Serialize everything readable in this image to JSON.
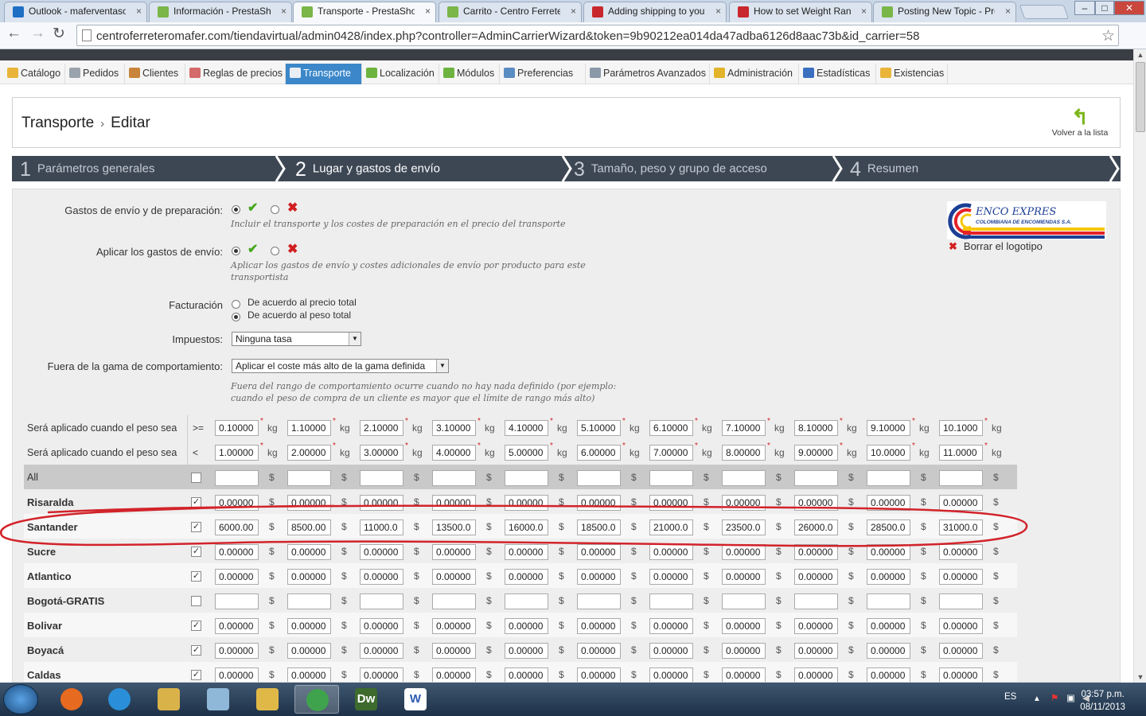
{
  "browser": {
    "tabs": [
      {
        "title": "Outlook - maferventaso",
        "color": "#1f6fc5"
      },
      {
        "title": "Información - PrestaSho",
        "color": "#7ab648"
      },
      {
        "title": "Transporte - PrestaShop",
        "color": "#7ab648",
        "active": true
      },
      {
        "title": "Carrito - Centro Ferreter",
        "color": "#7ab648"
      },
      {
        "title": "Adding shipping to you",
        "color": "#c8282d"
      },
      {
        "title": "How to set Weight Rang",
        "color": "#c8282d"
      },
      {
        "title": "Posting New Topic - Pre",
        "color": "#7ab648"
      }
    ],
    "url": "centroferreteromafer.com/tiendavirtual/admin0428/index.php?controller=AdminCarrierWizard&token=9b90212ea014da47adba6126d8aac73b&id_carrier=58"
  },
  "menu": [
    {
      "label": "Catálogo",
      "icon": "folder-icon",
      "color": "#e8b53a"
    },
    {
      "label": "Pedidos",
      "icon": "cart-icon",
      "color": "#9aa3ad"
    },
    {
      "label": "Clientes",
      "icon": "user-icon",
      "color": "#c9843b"
    },
    {
      "label": "Reglas de precios",
      "icon": "price-rules-icon",
      "color": "#d46a6a"
    },
    {
      "label": "Transporte",
      "icon": "truck-icon",
      "color": "#e9eef4",
      "active": true
    },
    {
      "label": "Localización",
      "icon": "globe-icon",
      "color": "#6db33f"
    },
    {
      "label": "Módulos",
      "icon": "puzzle-icon",
      "color": "#6db33f"
    },
    {
      "label": "Preferencias",
      "icon": "preferences-icon",
      "color": "#5a8bc2"
    },
    {
      "label": "Parámetros Avanzados",
      "icon": "wrench-icon",
      "color": "#8a98a8"
    },
    {
      "label": "Administración",
      "icon": "key-icon",
      "color": "#e1b42a"
    },
    {
      "label": "Estadísticas",
      "icon": "chart-icon",
      "color": "#3b6fc0"
    },
    {
      "label": "Existencias",
      "icon": "stock-icon",
      "color": "#e8b53a"
    }
  ],
  "header": {
    "breadcrumb_1": "Transporte",
    "breadcrumb_sep": "›",
    "breadcrumb_2": "Editar",
    "back_label": "Volver a la lista"
  },
  "steps": [
    {
      "num": "1",
      "label": "Parámetros generales"
    },
    {
      "num": "2",
      "label": "Lugar y gastos de envío",
      "active": true
    },
    {
      "num": "3",
      "label": "Tamaño, peso y grupo de acceso"
    },
    {
      "num": "4",
      "label": "Resumen"
    }
  ],
  "form": {
    "handling_label": "Gastos de envío y de preparación:",
    "handling_hint": "Incluir el transporte y los costes de preparación en el precio del transporte",
    "apply_label": "Aplicar los gastos de envío:",
    "apply_hint": "Aplicar los gastos de envío y costes adicionales de envío por producto para este transportista",
    "billing_label": "Facturación",
    "billing_opt1": "De acuerdo al precio total",
    "billing_opt2": "De acuerdo al peso total",
    "tax_label": "Impuestos:",
    "tax_value": "Ninguna tasa",
    "outrange_label": "Fuera de la gama de comportamiento:",
    "outrange_value": "Aplicar el coste más alto de la gama definida",
    "outrange_hint": "Fuera del rango de comportamiento ocurre cuando no hay nada definido (por ejemplo: cuando el peso de compra de un cliente es mayor que el límite de rango más alto)",
    "delete_logo": "Borrar el logotipo",
    "logo_text_1": "ENCO EXPRES",
    "logo_text_2": "COLOMBIANA DE ENCOMIENDAS S.A."
  },
  "ranges": {
    "from_label": "Será aplicado cuando el peso sea",
    "from_op": ">=",
    "to_label": "Será aplicado cuando el peso sea",
    "to_op": "<",
    "unit": "kg",
    "currency": "$",
    "from": [
      "0.10000",
      "1.10000",
      "2.10000",
      "3.10000",
      "4.10000",
      "5.10000",
      "6.10000",
      "7.10000",
      "8.10000",
      "9.10000",
      "10.1000"
    ],
    "to": [
      "1.00000",
      "2.00000",
      "3.00000",
      "4.00000",
      "5.00000",
      "6.00000",
      "7.00000",
      "8.00000",
      "9.00000",
      "10.0000",
      "11.0000"
    ]
  },
  "zones": [
    {
      "name": "All",
      "checked": false,
      "values": [
        "",
        "",
        "",
        "",
        "",
        "",
        "",
        "",
        "",
        "",
        ""
      ]
    },
    {
      "name": "Risaralda",
      "checked": true,
      "values": [
        "0.00000",
        "0.00000",
        "0.00000",
        "0.00000",
        "0.00000",
        "0.00000",
        "0.00000",
        "0.00000",
        "0.00000",
        "0.00000",
        "0.00000"
      ]
    },
    {
      "name": "Santander",
      "checked": true,
      "values": [
        "6000.00",
        "8500.00",
        "11000.0",
        "13500.0",
        "16000.0",
        "18500.0",
        "21000.0",
        "23500.0",
        "26000.0",
        "28500.0",
        "31000.0"
      ]
    },
    {
      "name": "Sucre",
      "checked": true,
      "values": [
        "0.00000",
        "0.00000",
        "0.00000",
        "0.00000",
        "0.00000",
        "0.00000",
        "0.00000",
        "0.00000",
        "0.00000",
        "0.00000",
        "0.00000"
      ]
    },
    {
      "name": "Atlantico",
      "checked": true,
      "values": [
        "0.00000",
        "0.00000",
        "0.00000",
        "0.00000",
        "0.00000",
        "0.00000",
        "0.00000",
        "0.00000",
        "0.00000",
        "0.00000",
        "0.00000"
      ]
    },
    {
      "name": "Bogotá-GRATIS",
      "checked": false,
      "values": [
        "",
        "",
        "",
        "",
        "",
        "",
        "",
        "",
        "",
        "",
        ""
      ]
    },
    {
      "name": "Bolivar",
      "checked": true,
      "values": [
        "0.00000",
        "0.00000",
        "0.00000",
        "0.00000",
        "0.00000",
        "0.00000",
        "0.00000",
        "0.00000",
        "0.00000",
        "0.00000",
        "0.00000"
      ]
    },
    {
      "name": "Boyacá",
      "checked": true,
      "values": [
        "0.00000",
        "0.00000",
        "0.00000",
        "0.00000",
        "0.00000",
        "0.00000",
        "0.00000",
        "0.00000",
        "0.00000",
        "0.00000",
        "0.00000"
      ]
    },
    {
      "name": "Caldas",
      "checked": true,
      "values": [
        "0.00000",
        "0.00000",
        "0.00000",
        "0.00000",
        "0.00000",
        "0.00000",
        "0.00000",
        "0.00000",
        "0.00000",
        "0.00000",
        "0.00000"
      ]
    }
  ],
  "taskbar": {
    "lang": "ES",
    "time": "03:57 p.m.",
    "date": "08/11/2013",
    "apps": [
      "firefox-icon",
      "ie-icon",
      "explorer-icon",
      "notepad-icon",
      "folder-icon",
      "chrome-icon",
      "dreamweaver-icon",
      "word-icon"
    ],
    "dreamweaver_label": "Dw",
    "word_label": "W"
  },
  "annotation_color": "#d2232a"
}
